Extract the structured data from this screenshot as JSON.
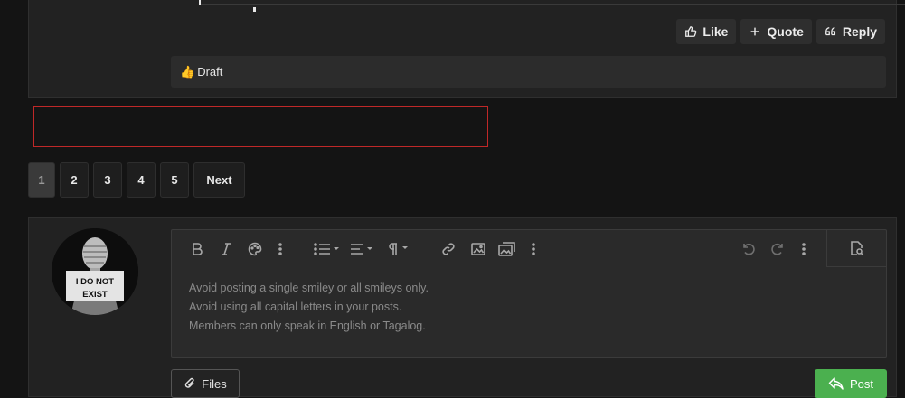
{
  "post": {
    "actions": {
      "like": "Like",
      "quote": "Quote",
      "reply": "Reply"
    },
    "reaction": {
      "emoji": "👍",
      "label": "Draft"
    }
  },
  "pagination": {
    "pages": [
      "1",
      "2",
      "3",
      "4",
      "5"
    ],
    "current": "1",
    "next": "Next"
  },
  "composer": {
    "avatar_sign": [
      "I DO NOT",
      "EXIST"
    ],
    "toolbar_icons": [
      "bold-icon",
      "italic-icon",
      "palette-icon",
      "more-icon",
      "list-icon",
      "align-icon",
      "paragraph-icon",
      "link-icon",
      "image-icon",
      "media-icon",
      "more-icon",
      "undo-icon",
      "redo-icon",
      "more-icon",
      "preview-icon"
    ],
    "placeholder_lines": [
      "Avoid posting a single smiley or all smileys only.",
      "Avoid using all capital letters in your posts.",
      "Members can only speak in English or Tagalog."
    ],
    "files_label": "Files",
    "post_label": "Post"
  },
  "colors": {
    "background": "#141414",
    "panel": "#222222",
    "accent_green": "#4bb04f",
    "ad_border": "#c02828"
  }
}
